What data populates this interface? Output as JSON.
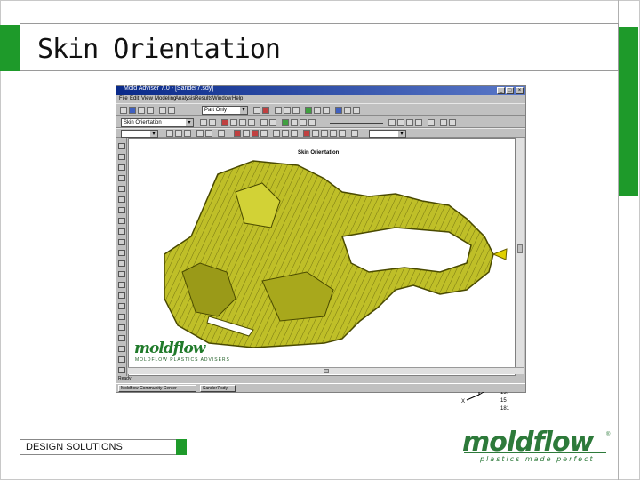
{
  "slide": {
    "title": "Skin Orientation",
    "footer_label": "DESIGN SOLUTIONS",
    "logo": {
      "name": "moldflow",
      "reg": "®",
      "tagline": "plastics made perfect"
    },
    "accent_color": "#1e9a2a"
  },
  "window": {
    "title": "Mold Adviser 7.0 - [Sander7.sdy]",
    "controls": [
      "_",
      "□",
      "×"
    ],
    "menu": [
      "File",
      "Edit",
      "View",
      "Modeling",
      "Analysis",
      "Results",
      "Window",
      "Help"
    ],
    "combos": {
      "part": "Part Only",
      "result": "Skin Orientation"
    },
    "viewport_title": "Skin Orientation",
    "axes": {
      "x": "X",
      "y": "Y",
      "z": "Z"
    },
    "coords": [
      "137",
      "15",
      "181"
    ],
    "inner_logo": {
      "name": "moldflow",
      "tagline": "MOLDFLOW PLASTICS ADVISERS"
    },
    "status": "Ready",
    "taskbar": [
      "Moldflow Community Center",
      "Sander7.sdy"
    ]
  }
}
